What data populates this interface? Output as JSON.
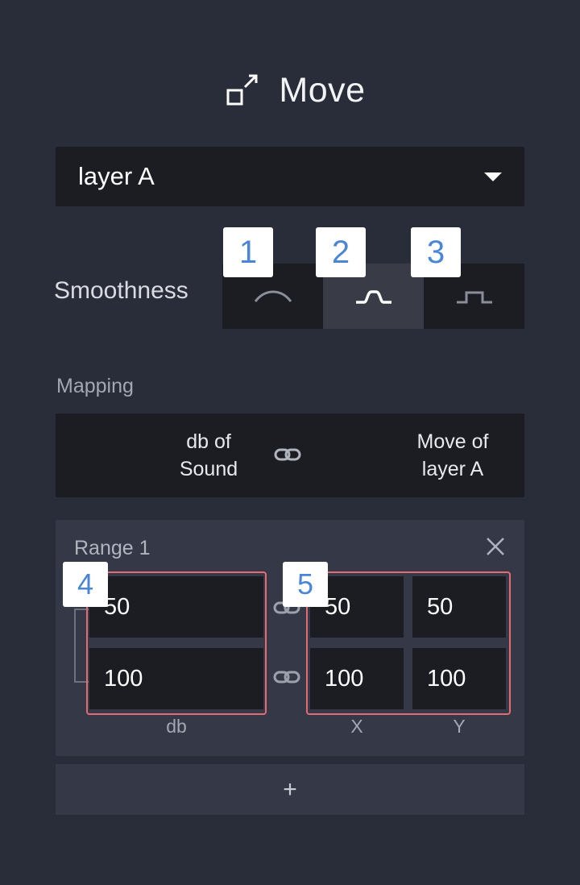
{
  "header": {
    "title": "Move",
    "icon": "move-resize-icon"
  },
  "layer_select": {
    "value": "layer A"
  },
  "smoothness": {
    "label": "Smoothness",
    "options": [
      {
        "badge": "1",
        "icon": "smooth-curve-icon",
        "active": false
      },
      {
        "badge": "2",
        "icon": "medium-curve-icon",
        "active": true
      },
      {
        "badge": "3",
        "icon": "step-curve-icon",
        "active": false
      }
    ]
  },
  "mapping": {
    "label": "Mapping",
    "source_line1": "db of",
    "source_line2": "Sound",
    "target_line1": "Move of",
    "target_line2": "layer A",
    "link_icon": "link-icon"
  },
  "range": {
    "title": "Range 1",
    "close_icon": "close-icon",
    "db": {
      "min": "50",
      "max": "100",
      "label": "db"
    },
    "x": {
      "min": "50",
      "max": "100",
      "label": "X"
    },
    "y": {
      "min": "50",
      "max": "100",
      "label": "Y"
    },
    "badges": [
      "4",
      "5"
    ]
  },
  "add_range": {
    "label": "+"
  },
  "colors": {
    "background": "#292d3a",
    "field": "#1b1d23",
    "panel": "#353947",
    "highlight": "#e46b70",
    "badge_text": "#4a86d8"
  }
}
